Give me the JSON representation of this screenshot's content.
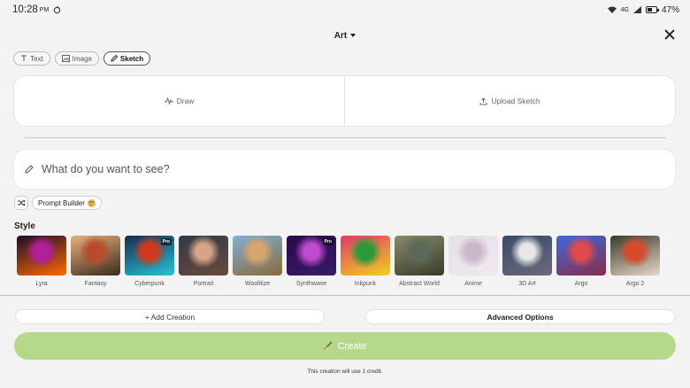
{
  "status": {
    "time": "10:28",
    "ampm": "PM",
    "network": "4G",
    "battery": "47%"
  },
  "header": {
    "title": "Art"
  },
  "modes": [
    {
      "label": "Text",
      "icon": "text-icon",
      "active": false
    },
    {
      "label": "Image",
      "icon": "image-icon",
      "active": false
    },
    {
      "label": "Sketch",
      "icon": "pencil-icon",
      "active": true
    }
  ],
  "sketch": {
    "draw_label": "Draw",
    "upload_label": "Upload Sketch"
  },
  "prompt": {
    "placeholder": "What do you want to see?"
  },
  "prompt_builder": {
    "label": "Prompt Builder"
  },
  "style_section": {
    "label": "Style",
    "items": [
      {
        "name": "Lyra",
        "pro": false,
        "colors": [
          "#1a0a2a",
          "#b0209a",
          "#ff6a00"
        ]
      },
      {
        "name": "Fantasy",
        "pro": false,
        "colors": [
          "#e7b27a",
          "#b84b2b",
          "#3a2a1e"
        ]
      },
      {
        "name": "Cyberpunk",
        "pro": true,
        "colors": [
          "#1b2a4a",
          "#d2391c",
          "#26c6da"
        ]
      },
      {
        "name": "Portrait",
        "pro": false,
        "colors": [
          "#2e3a4a",
          "#d7a48a",
          "#6b4a3a"
        ]
      },
      {
        "name": "Woolitize",
        "pro": false,
        "colors": [
          "#7fb0d8",
          "#d7a56a",
          "#8a6a3a"
        ]
      },
      {
        "name": "Synthwave",
        "pro": true,
        "colors": [
          "#2a0a4a",
          "#c04ad0",
          "#3a1a6a"
        ]
      },
      {
        "name": "Inkpunk",
        "pro": false,
        "colors": [
          "#e03a6a",
          "#2a9a3a",
          "#f0d020"
        ]
      },
      {
        "name": "Abstract World",
        "pro": false,
        "colors": [
          "#8a8a6a",
          "#5a6a5a",
          "#3a3a2a"
        ]
      },
      {
        "name": "Anime",
        "pro": false,
        "colors": [
          "#e8e0e8",
          "#c8b8c8",
          "#f0e8f0"
        ]
      },
      {
        "name": "3D Art",
        "pro": false,
        "colors": [
          "#3a4a6a",
          "#e8e8e8",
          "#6a6a7a"
        ]
      },
      {
        "name": "Argo",
        "pro": false,
        "colors": [
          "#3a6ad8",
          "#e04a4a",
          "#8a2a4a"
        ]
      },
      {
        "name": "Argo 2",
        "pro": false,
        "colors": [
          "#3a3a2a",
          "#d84a2a",
          "#e8d8c8"
        ]
      }
    ]
  },
  "actions": {
    "add_creation": "+ Add Creation",
    "advanced_options": "Advanced Options",
    "create": "Create",
    "credit_note": "This creation will use 1 credit."
  },
  "colors": {
    "create_button": "#b6d88a",
    "background": "#f3f3f3"
  }
}
